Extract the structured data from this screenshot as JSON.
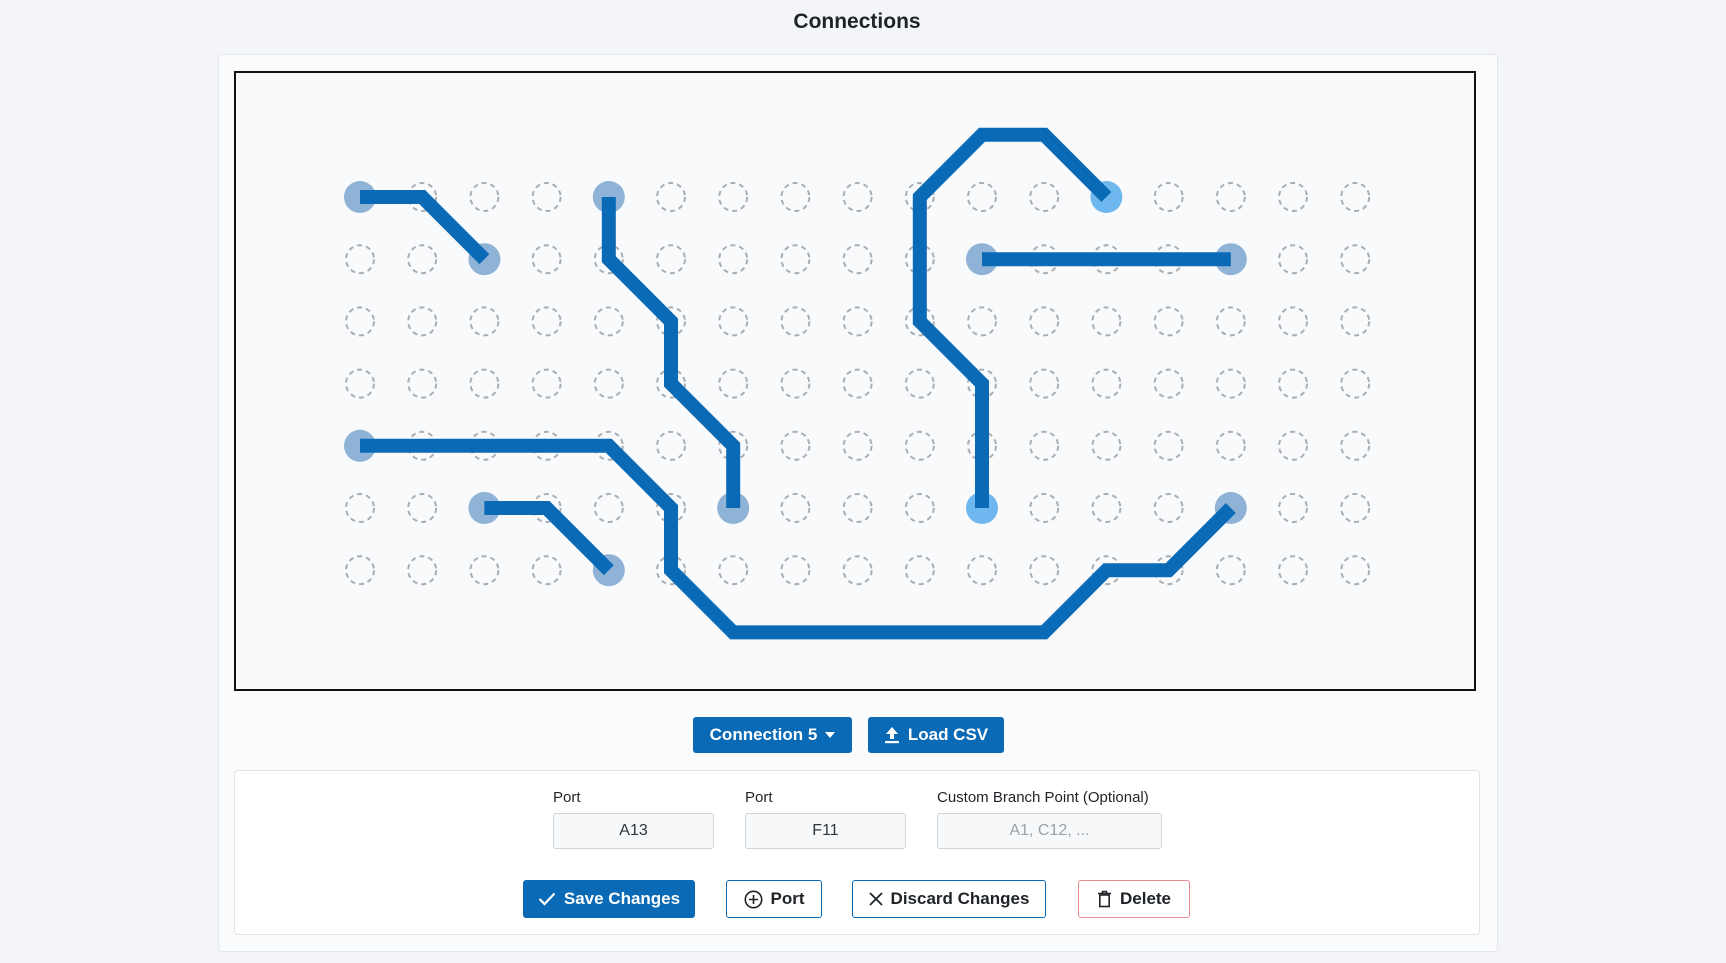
{
  "page": {
    "title": "Connections"
  },
  "board": {
    "colors": {
      "trace": "#0a6ab6",
      "pad": "#8fb3d6",
      "pad_active": "#6fb8ef",
      "hole": "#a9aeb4"
    },
    "grid": {
      "cols": 17,
      "rows": 7
    },
    "traces": [
      {
        "points": [
          [
            0,
            0
          ],
          [
            1,
            0
          ],
          [
            2,
            1
          ]
        ],
        "ends": [
          "pad",
          "pad"
        ]
      },
      {
        "points": [
          [
            4,
            0
          ],
          [
            4,
            1
          ],
          [
            5,
            2
          ],
          [
            5,
            3
          ],
          [
            6,
            4
          ],
          [
            6,
            5
          ]
        ],
        "ends": [
          "pad",
          "pad"
        ]
      },
      {
        "points": [
          [
            0,
            4
          ],
          [
            4,
            4
          ],
          [
            5,
            5
          ],
          [
            5,
            6
          ],
          [
            6,
            7
          ],
          [
            11,
            7
          ],
          [
            12,
            6
          ],
          [
            13,
            6
          ],
          [
            14,
            5
          ]
        ],
        "ends": [
          "pad",
          "pad"
        ]
      },
      {
        "points": [
          [
            2,
            5
          ],
          [
            3,
            5
          ],
          [
            4,
            6
          ]
        ],
        "ends": [
          "pad",
          "pad"
        ]
      },
      {
        "points": [
          [
            12,
            0
          ],
          [
            11,
            -1
          ],
          [
            10,
            -1
          ],
          [
            9,
            0
          ],
          [
            9,
            2
          ],
          [
            10,
            3
          ],
          [
            10,
            5
          ]
        ],
        "ends": [
          "active",
          "active"
        ]
      },
      {
        "points": [
          [
            10,
            1
          ],
          [
            14,
            1
          ]
        ],
        "ends": [
          "pad",
          "pad"
        ]
      }
    ]
  },
  "toolbar": {
    "connection_select": "Connection 5",
    "load_csv": "Load CSV"
  },
  "form": {
    "port1": {
      "label": "Port",
      "value": "A13"
    },
    "port2": {
      "label": "Port",
      "value": "F11"
    },
    "branch": {
      "label": "Custom Branch Point (Optional)",
      "value": "",
      "placeholder": "A1, C12, ..."
    },
    "save": "Save Changes",
    "add_port": "Port",
    "discard": "Discard Changes",
    "delete": "Delete"
  }
}
